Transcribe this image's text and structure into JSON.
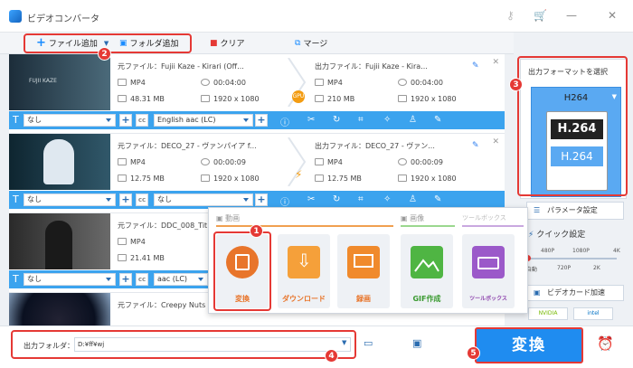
{
  "window": {
    "title": "ビデオコンバータ"
  },
  "toolbar": {
    "add_file": "ファイル追加",
    "add_folder": "フォルダ追加",
    "clear": "クリア",
    "merge": "マージ"
  },
  "rows": [
    {
      "src": "元ファイル：Fujii Kaze - Kirari (Off...",
      "out": "出力ファイル：Fujii Kaze - Kira...",
      "fmt_in": "MP4",
      "dur_in": "00:04:00",
      "size_in": "48.31 MB",
      "res_in": "1920 x 1080",
      "fmt_out": "MP4",
      "dur_out": "00:04:00",
      "size_out": "210 MB",
      "res_out": "1920 x 1080",
      "sub": "なし",
      "audio": "English aac (LC)",
      "thumb_text": "FUJII KAZE"
    },
    {
      "src": "元ファイル：DECO_27 - ヴァンパイア f...",
      "out": "出力ファイル：DECO_27 - ヴァン...",
      "fmt_in": "MP4",
      "dur_in": "00:00:09",
      "size_in": "12.75 MB",
      "res_in": "1920 x 1080",
      "fmt_out": "MP4",
      "dur_out": "00:00:09",
      "size_out": "12.75 MB",
      "res_out": "1920 x 1080",
      "sub": "なし",
      "audio": "なし",
      "thumb_text": ""
    },
    {
      "src": "元ファイル：DDC_008_Tit",
      "fmt_in": "MP4",
      "size_in": "21.41 MB",
      "sub": "なし",
      "audio": "aac (LC)"
    },
    {
      "src": "元ファイル：Creepy Nuts"
    }
  ],
  "gpu_label": "GPU",
  "popup": {
    "tab_video": "動画",
    "tab_image": "画像",
    "tab_toolbox": "ツールボックス",
    "tiles": [
      {
        "label": "変換",
        "color": "#e8752b"
      },
      {
        "label": "ダウンロード",
        "color": "#f5a03a"
      },
      {
        "label": "録画",
        "color": "#f08a2c"
      },
      {
        "label": "GIF作成",
        "color": "#4fb543"
      },
      {
        "label": "ツールボックス",
        "color": "#9b59c9"
      }
    ]
  },
  "right": {
    "select_format": "出力フォーマットを選択",
    "format": "H264",
    "h264_a": "H.264",
    "h264_b": "H.264",
    "params": "パラメータ設定",
    "quick": "クイック設定",
    "ticks_top": [
      "480P",
      "1080P",
      "4K"
    ],
    "ticks_bottom": [
      "自動",
      "720P",
      "2K"
    ],
    "hw": "ビデオカード加速",
    "nvidia": "NVIDIA",
    "intel": "intel"
  },
  "bottom": {
    "folder_label": "出力フォルダ：",
    "folder_value": "D:¥ff¥wj",
    "convert": "変換"
  },
  "badges": [
    "1",
    "2",
    "3",
    "4",
    "5"
  ]
}
